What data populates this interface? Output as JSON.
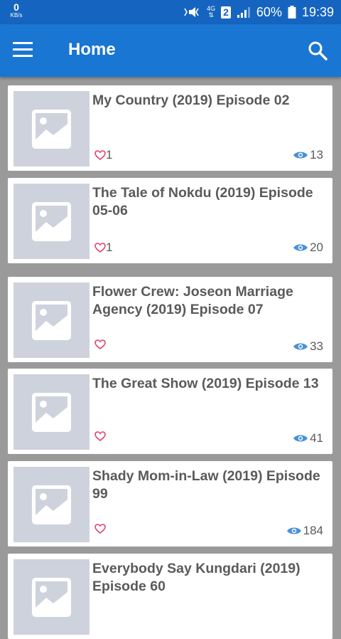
{
  "status_bar": {
    "net_speed_value": "0",
    "net_speed_unit": "KB/s",
    "network_type": "4G",
    "network_sub": "⇅",
    "sim_slot": "2",
    "battery_percent": "60%",
    "time": "19:39",
    "icons": [
      "mute-vibrate-icon",
      "signal-bars-icon",
      "battery-icon"
    ]
  },
  "app_bar": {
    "title": "Home",
    "icons": [
      "menu-icon",
      "search-icon"
    ]
  },
  "colors": {
    "status_bar": "#1565c0",
    "app_bar": "#1976d2",
    "background": "#9a9a9a",
    "heart": "#e2446f",
    "eye": "#4a90d9",
    "text": "#5a5a5a"
  },
  "items": [
    {
      "title": "My Country (2019) Episode 02",
      "likes": "1",
      "views": "13"
    },
    {
      "title": "The Tale of Nokdu (2019) Episode 05-06",
      "likes": "1",
      "views": "20"
    },
    {
      "title": "Flower Crew: Joseon Marriage Agency (2019) Episode 07",
      "likes": "",
      "views": "33"
    },
    {
      "title": "The Great Show (2019) Episode 13",
      "likes": "",
      "views": "41"
    },
    {
      "title": "Shady Mom-in-Law (2019) Episode 99",
      "likes": "",
      "views": "184"
    },
    {
      "title": "Everybody Say Kungdari (2019) Episode 60",
      "likes": "",
      "views": ""
    }
  ]
}
